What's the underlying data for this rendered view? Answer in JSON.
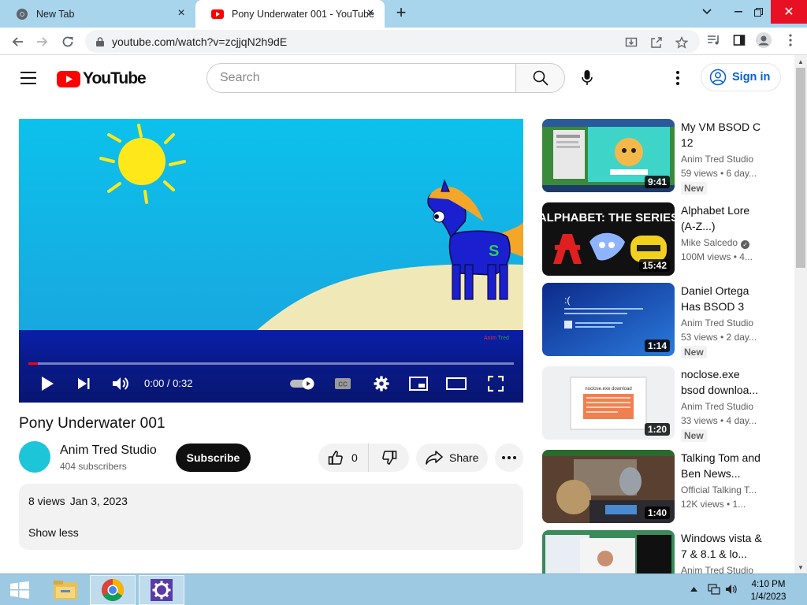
{
  "browser": {
    "tabs": [
      {
        "title": "New Tab"
      },
      {
        "title": "Pony Underwater 001 - YouTube"
      }
    ],
    "url": "youtube.com/watch?v=zcjjqN2h9dE"
  },
  "masthead": {
    "logo_text": "YouTube",
    "search_placeholder": "Search",
    "signin_label": "Sign in"
  },
  "player": {
    "time": "0:00 / 0:32",
    "progress": 0.02,
    "watermark_a": "Anim",
    "watermark_b": "Tred",
    "pony_mark": "S"
  },
  "video": {
    "title": "Pony Underwater 001",
    "channel": "Anim Tred Studio",
    "subscribers": "404 subscribers",
    "subscribe_label": "Subscribe",
    "like_count": "0",
    "share_label": "Share",
    "views": "8 views",
    "date": "Jan 3, 2023",
    "show_less": "Show less"
  },
  "recommendations": [
    {
      "title": "My VM BSOD C 12",
      "channel": "Anim Tred Studio",
      "meta": "59 views • 6 day...",
      "badge": "New",
      "duration": "9:41",
      "thumb_text": ""
    },
    {
      "title": "Alphabet Lore (A-Z...)",
      "channel": "Mike Salcedo",
      "verified": true,
      "meta": "100M views • 4...",
      "badge": "",
      "duration": "15:42",
      "thumb_text": "ALPHABET: THE SERIES"
    },
    {
      "title": "Daniel Ortega Has BSOD 3",
      "channel": "Anim Tred Studio",
      "meta": "53 views • 2 day...",
      "badge": "New",
      "duration": "1:14",
      "thumb_text": ":("
    },
    {
      "title": "noclose.exe bsod downloa...",
      "channel": "Anim Tred Studio",
      "meta": "33 views • 4 day...",
      "badge": "New",
      "duration": "1:20",
      "thumb_text": "noclose.exe download"
    },
    {
      "title": "Talking Tom and Ben News...",
      "channel": "Official Talking T...",
      "meta": "12K views • 1...",
      "badge": "",
      "duration": "1:40",
      "thumb_text": ""
    },
    {
      "title": "Windows vista & 7 & 8.1 & lo...",
      "channel": "Anim Tred Studio",
      "meta": "",
      "badge": "",
      "duration": "",
      "thumb_text": ""
    }
  ],
  "taskbar": {
    "time": "4:10 PM",
    "date": "1/4/2023"
  },
  "colors": {
    "tabstrip": "#a8d4ec",
    "youtube_red": "#ff0000",
    "link_blue": "#065fd4",
    "taskbar": "#9dc9e2"
  }
}
